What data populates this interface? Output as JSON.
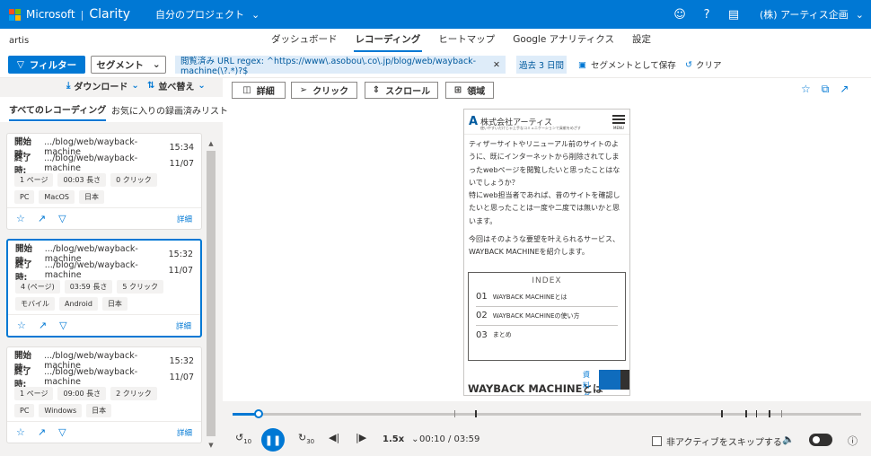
{
  "topbar": {
    "brand": "Microsoft",
    "product": "Clarity",
    "project": "自分のプロジェクト",
    "account": "(株) アーティス企画",
    "icons": [
      "smiley-icon",
      "help-icon",
      "document-icon"
    ]
  },
  "site_name": "artis",
  "nav_tabs": [
    "ダッシュボード",
    "レコーディング",
    "ヒートマップ",
    "Google アナリティクス",
    "設定"
  ],
  "filters": {
    "filter_button": "フィルター",
    "segment_button": "セグメント",
    "url_chip": "閲覧済み URL regex: ^https://www\\.asobou\\.co\\.jp/blog/web/wayback-machine(\\?.*)?$",
    "date_chip": "過去 3 日間",
    "save_segment": "セグメントとして保存",
    "clear": "クリア"
  },
  "left": {
    "download": "ダウンロード",
    "sort": "並べ替え",
    "tab_all": "すべてのレコーディング",
    "tab_fav": "お気に入りの録画済みリスト"
  },
  "recordings": [
    {
      "start_label": "開始時:",
      "start": ".../blog/web/wayback-machine",
      "start_time": "15:34",
      "end_label": "終了時:",
      "end": ".../blog/web/wayback-machine",
      "end_date": "11/07",
      "tags1": [
        "1 ページ",
        "00:03 長さ",
        "0 クリック"
      ],
      "tags2": [
        "PC",
        "MacOS",
        "日本"
      ],
      "detail": "詳細"
    },
    {
      "start_label": "開始時:",
      "start": ".../blog/web/wayback-machine",
      "start_time": "15:32",
      "end_label": "終了時:",
      "end": ".../blog/web/wayback-machine",
      "end_date": "11/07",
      "tags1": [
        "4 (ページ)",
        "03:59 長さ",
        "5 クリック"
      ],
      "tags2": [
        "モバイル",
        "Android",
        "日本"
      ],
      "detail": "詳細"
    },
    {
      "start_label": "開始時:",
      "start": ".../blog/web/wayback-machine",
      "start_time": "15:32",
      "end_label": "終了時:",
      "end": ".../blog/web/wayback-machine",
      "end_date": "11/07",
      "tags1": [
        "1 ページ",
        "09:00 長さ",
        "2 クリック"
      ],
      "tags2": [
        "PC",
        "Windows",
        "日本"
      ],
      "detail": "詳細"
    }
  ],
  "toolbar": {
    "detail": "詳細",
    "click": "クリック",
    "scroll": "スクロール",
    "area": "領域"
  },
  "preview": {
    "company": "株式会社アーティス",
    "tagline": "使いやすいだけじゃ上手なコミュニケーションで貢献をめざす",
    "menu_label": "MENU",
    "para1": "ティザーサイトやリニューアル前のサイトのように、既にインターネットから削除されてしまったwebページを閲覧したいと思ったことはないでしょうか？",
    "para2": "特にweb担当者であれば、昔のサイトを確認したいと思ったことは一度や二度では無いかと思います。",
    "para3": "今回はそのような要望を叶えられるサービス、WAYBACK MACHINEを紹介します。",
    "index_title": "INDEX",
    "index": [
      {
        "num": "01",
        "text": "WAYBACK MACHINEとは"
      },
      {
        "num": "02",
        "text": "WAYBACK MACHINEの使い方"
      },
      {
        "num": "03",
        "text": "まとめ"
      }
    ],
    "heading": "WAYBACK MACHINEとは",
    "download_tab": "資料ダウ"
  },
  "player": {
    "back_seconds": "10",
    "forward_seconds": "30",
    "speed": "1.5x",
    "time": "00:10 / 03:59",
    "progress": 0.042,
    "skip_inactive": "非アクティブをスキップする"
  }
}
